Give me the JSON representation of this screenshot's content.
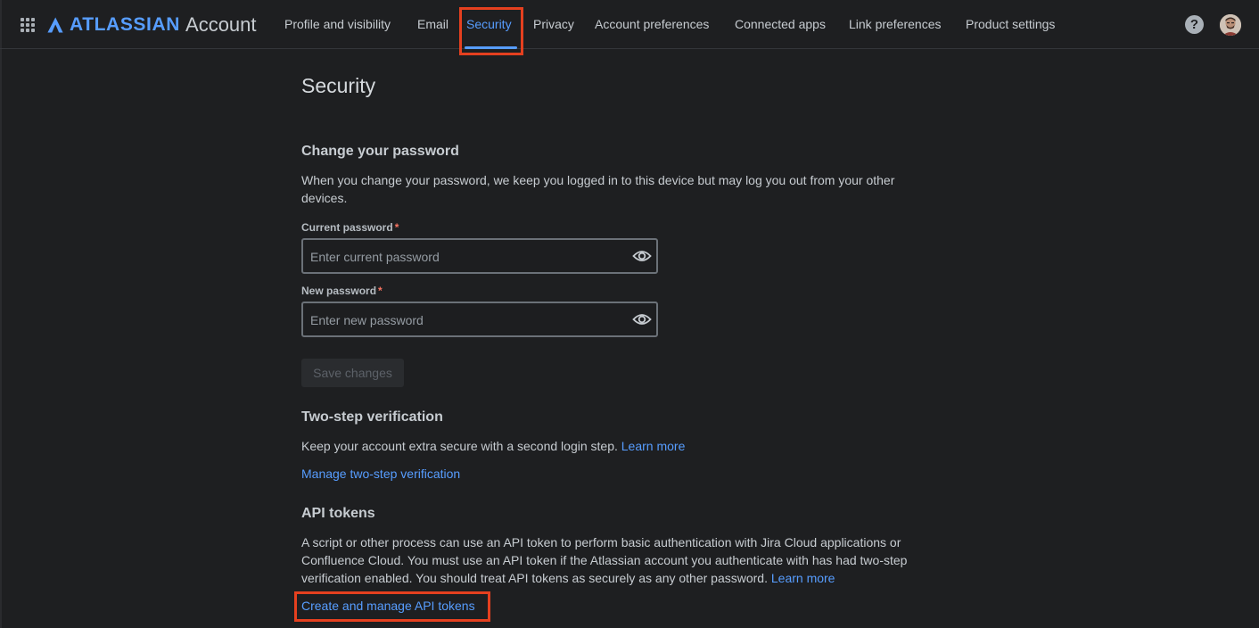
{
  "brand": {
    "name": "ATLASSIAN",
    "suffix": "Account"
  },
  "nav": {
    "tabs": [
      {
        "label": "Profile and visibility"
      },
      {
        "label": "Email"
      },
      {
        "label": "Security"
      },
      {
        "label": "Privacy"
      },
      {
        "label": "Account preferences"
      },
      {
        "label": "Connected apps"
      },
      {
        "label": "Link preferences"
      },
      {
        "label": "Product settings"
      }
    ],
    "active_tab": "Security",
    "help_glyph": "?"
  },
  "icons": {
    "app_switcher": "grid-icon",
    "help": "help-icon",
    "eye": "eye-icon"
  },
  "colors": {
    "accent": "#579dff",
    "highlight": "#e5401f",
    "background": "#1e1f21"
  },
  "page": {
    "title": "Security"
  },
  "password": {
    "heading": "Change your password",
    "description": "When you change your password, we keep you logged in to this device but may log you out from your other devices.",
    "current_label": "Current password",
    "current_placeholder": "Enter current password",
    "new_label": "New password",
    "new_placeholder": "Enter new password",
    "required_marker": "*",
    "save_label": "Save changes"
  },
  "two_step": {
    "heading": "Two-step verification",
    "description": "Keep your account extra secure with a second login step.",
    "learn_more": "Learn more",
    "manage_link": "Manage two-step verification"
  },
  "api_tokens": {
    "heading": "API tokens",
    "description": "A script or other process can use an API token to perform basic authentication with Jira Cloud applications or Confluence Cloud. You must use an API token if the Atlassian account you authenticate with has had two-step verification enabled. You should treat API tokens as securely as any other password.",
    "learn_more": "Learn more",
    "manage_link": "Create and manage API tokens"
  }
}
